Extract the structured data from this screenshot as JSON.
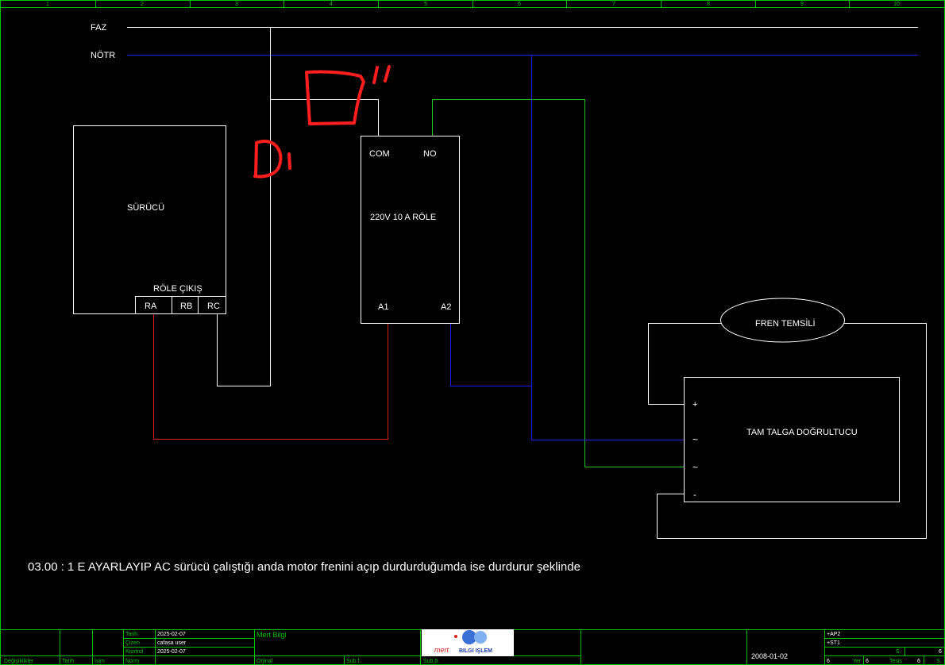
{
  "ruler": {
    "numbers": [
      "1",
      "2",
      "3",
      "4",
      "5",
      "6",
      "7",
      "8",
      "9",
      "10"
    ]
  },
  "rails": {
    "phase": "FAZ",
    "neutral": "NÖTR"
  },
  "driver": {
    "title": "SÜRÜCÜ",
    "relay_output": "RÖLE ÇIKIŞ",
    "terminals": [
      "RA",
      "RB",
      "RC"
    ]
  },
  "relay": {
    "com": "COM",
    "no": "NO",
    "rating": "220V 10 A  RÖLE",
    "a1": "A1",
    "a2": "A2"
  },
  "brake": {
    "label": "FREN TEMSİLİ"
  },
  "rectifier": {
    "title": "TAM TALGA DOĞRULTUCU",
    "plus": "+",
    "ac1": "~",
    "ac2": "~",
    "minus": "-"
  },
  "annotations": {
    "mark1": "D'",
    "mark2": "D\""
  },
  "note": "03.00 : 1 E AYARLAYIP  AC sürücü çalıştığı anda motor frenini açıp durdurduğumda ise durdurur şeklinde",
  "title_block": {
    "left_labels": [
      "Değişiklikler",
      "Tarih",
      "İsim"
    ],
    "row_labels": [
      "Tarih",
      "Çizen",
      "Kontrol",
      "Norm"
    ],
    "row_values": [
      "2025-02-07",
      "cafasa user",
      "2025-02-07",
      ""
    ],
    "company": "Mert Bilgi",
    "orijinal": "Orjinal",
    "sub_for": "Sub.f.",
    "sub_by": "Sub.b.",
    "logo_brand": "mert",
    "logo_text": "BILGI IŞLEM",
    "date": "2008-01-02",
    "ap": "+AP2",
    "st": "+ST1",
    "s_label": "S.",
    "s_value": "6",
    "page_a": "6",
    "yer": "Yer",
    "yer_val": "6",
    "tesis": "Tesis",
    "tesis_val": "6",
    "s2": "S."
  },
  "colors": {
    "background": "#000000",
    "frame": "#00c000",
    "phase": "#ffffff",
    "neutral": "#1a1aff",
    "red_wire": "#e01818",
    "green_wire": "#22c522",
    "markup": "#ff1e1e"
  }
}
